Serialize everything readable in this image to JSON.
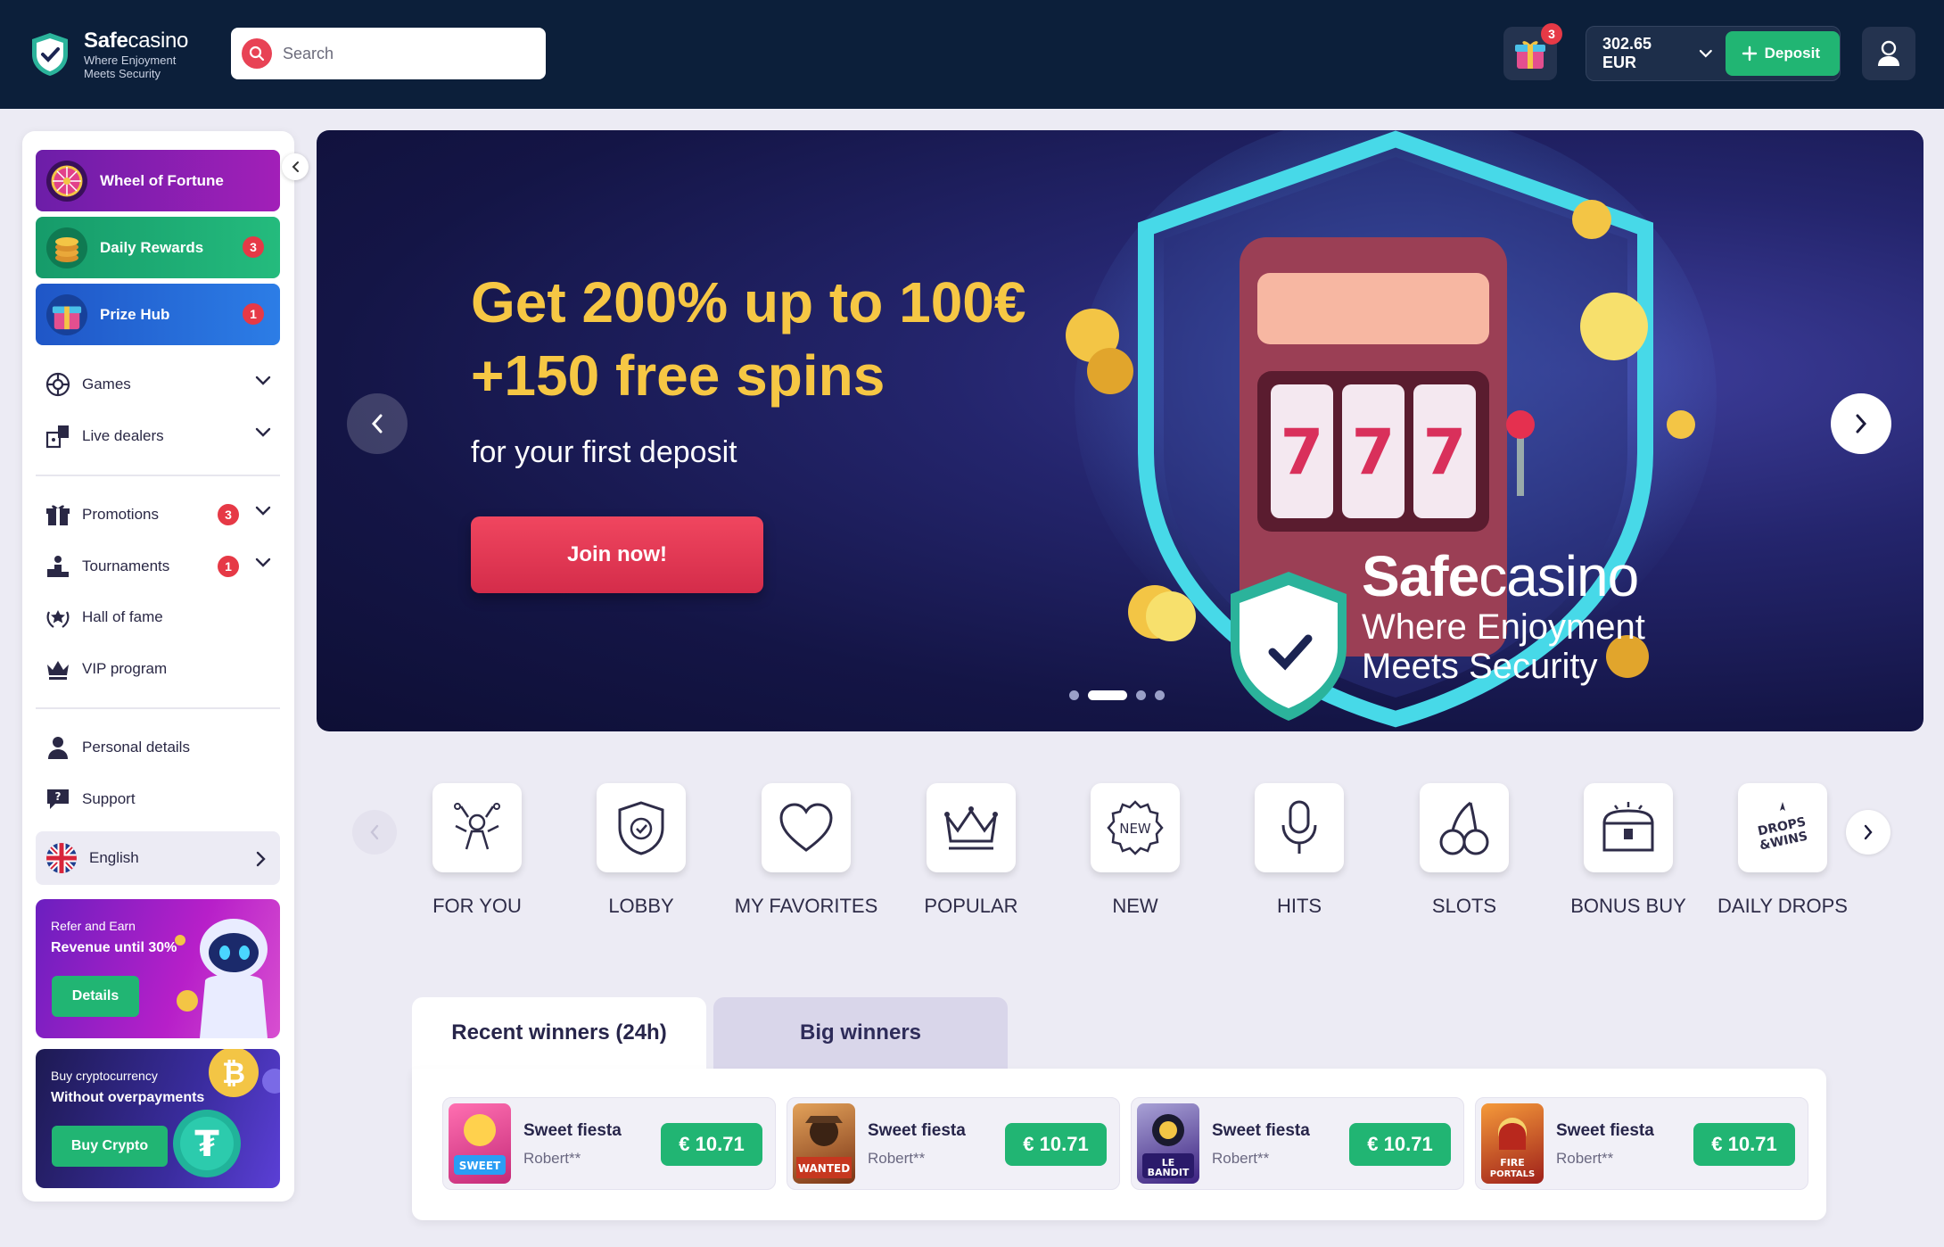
{
  "header": {
    "logo_name_bold": "Safe",
    "logo_name_rest": "casino",
    "logo_tagline": "Where Enjoyment Meets Security",
    "search_placeholder": "Search",
    "gift_badge": "3",
    "balance": "302.65 EUR",
    "deposit_label": "Deposit"
  },
  "sidebar": {
    "tiles": [
      {
        "label": "Wheel of Fortune",
        "badge": ""
      },
      {
        "label": "Daily Rewards",
        "badge": "3"
      },
      {
        "label": "Prize Hub",
        "badge": "1"
      }
    ],
    "nav": [
      {
        "label": "Games",
        "icon": "games-icon"
      },
      {
        "label": "Live dealers",
        "icon": "live-dealers-icon"
      },
      {
        "label": "Promotions",
        "icon": "gift-icon",
        "badge": "3"
      },
      {
        "label": "Tournaments",
        "icon": "podium-icon",
        "badge": "1"
      },
      {
        "label": "Hall of fame",
        "icon": "laurel-star-icon"
      },
      {
        "label": "VIP program",
        "icon": "crown-icon"
      },
      {
        "label": "Personal details",
        "icon": "person-icon"
      },
      {
        "label": "Support",
        "icon": "support-icon"
      }
    ],
    "language": "English",
    "ads": [
      {
        "small": "Refer and Earn",
        "big": "Revenue until 30%",
        "button": "Details"
      },
      {
        "small": "Buy cryptocurrency",
        "big": "Without overpayments",
        "button": "Buy Crypto"
      }
    ]
  },
  "hero": {
    "title": "Get 200% up to 100€ +150 free spins",
    "subtitle": "for your first deposit",
    "cta": "Join now!",
    "brand_bold": "Safe",
    "brand_rest": "casino",
    "brand_tagline": "Where Enjoyment Meets Security",
    "slides": 4,
    "active_slide": 2
  },
  "categories": [
    {
      "label": "FOR YOU",
      "icon": "for-you-icon"
    },
    {
      "label": "LOBBY",
      "icon": "lobby-shield-icon"
    },
    {
      "label": "MY FAVORITES",
      "icon": "heart-icon"
    },
    {
      "label": "POPULAR",
      "icon": "crown-icon"
    },
    {
      "label": "NEW",
      "icon": "new-badge-icon"
    },
    {
      "label": "HITS",
      "icon": "microphone-icon"
    },
    {
      "label": "SLOTS",
      "icon": "cherry-icon"
    },
    {
      "label": "BONUS BUY",
      "icon": "treasure-chest-icon"
    },
    {
      "label": "DAILY DROPS",
      "icon": "drops-wins-icon"
    }
  ],
  "winners": {
    "tabs": [
      "Recent winners (24h)",
      "Big winners"
    ],
    "items": [
      {
        "game": "Sweet fiesta",
        "user": "Robert**",
        "amount": "€ 10.71",
        "thumb": "SWEET FIESTA",
        "thumb_color": "#e83f8e"
      },
      {
        "game": "Sweet fiesta",
        "user": "Robert**",
        "amount": "€ 10.71",
        "thumb": "WANTED DEAD or WILD",
        "thumb_color": "#b4542c"
      },
      {
        "game": "Sweet fiesta",
        "user": "Robert**",
        "amount": "€ 10.71",
        "thumb": "LE BANDIT",
        "thumb_color": "#4a2a9a"
      },
      {
        "game": "Sweet fiesta",
        "user": "Robert**",
        "amount": "€ 10.71",
        "thumb": "FIRE PORTALS",
        "thumb_color": "#c63b1f"
      }
    ]
  },
  "colors": {
    "topbar": "#0c1f3a",
    "accent_green": "#21b573",
    "accent_red": "#e63946",
    "hero_gold": "#f6c744"
  }
}
